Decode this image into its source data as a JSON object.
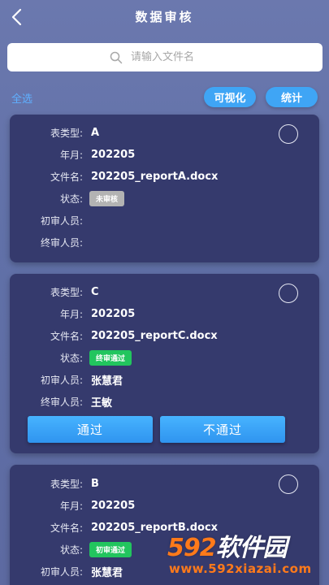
{
  "header": {
    "title": "数据审核"
  },
  "search": {
    "placeholder": "请输入文件名"
  },
  "toolbar": {
    "select_all": "全选",
    "visualize": "可视化",
    "stats": "统计"
  },
  "labels": {
    "type": "表类型:",
    "month": "年月:",
    "filename": "文件名:",
    "status": "状态:",
    "first_reviewer": "初审人员:",
    "final_reviewer": "终审人员:"
  },
  "cards": [
    {
      "type": "A",
      "month": "202205",
      "filename": "202205_reportA.docx",
      "status": "未审核",
      "first_reviewer": "",
      "final_reviewer": ""
    },
    {
      "type": "C",
      "month": "202205",
      "filename": "202205_reportC.docx",
      "status": "终审通过",
      "first_reviewer": "张慧君",
      "final_reviewer": "王敏",
      "approve": "通过",
      "reject": "不通过"
    },
    {
      "type": "B",
      "month": "202205",
      "filename": "202205_reportB.docx",
      "status": "初审通过",
      "first_reviewer": "张慧君",
      "final_reviewer": ""
    }
  ],
  "watermark": {
    "brand_num": "592",
    "brand_text": "软件园",
    "url": "www.592xiazai.com"
  },
  "colors": {
    "accent": "#3fa5f5",
    "card_bg": "#353a6d",
    "status_green": "#22c55e",
    "status_gray": "#b3b3b3",
    "brand_orange": "#ff7a1a"
  }
}
